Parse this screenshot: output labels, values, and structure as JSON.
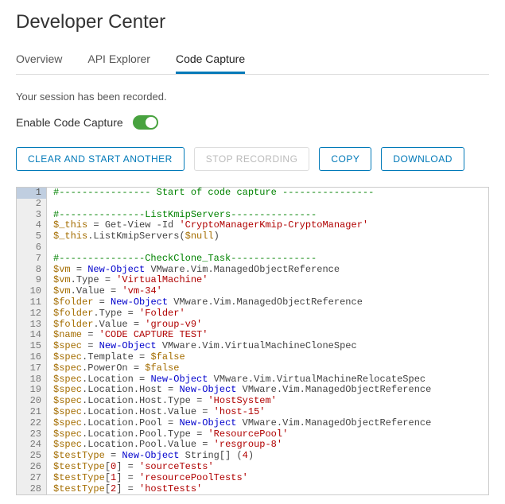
{
  "header": {
    "title": "Developer Center"
  },
  "tabs": {
    "items": [
      {
        "label": "Overview"
      },
      {
        "label": "API Explorer"
      },
      {
        "label": "Code Capture",
        "active": true
      }
    ]
  },
  "message": "Your session has been recorded.",
  "toggle_label": "Enable Code Capture",
  "buttons": {
    "clear": "CLEAR AND START ANOTHER",
    "stop": "STOP RECORDING",
    "copy": "COPY",
    "download": "DOWNLOAD"
  },
  "code": [
    [
      [
        "comment",
        "#---------------- Start of code capture ----------------"
      ]
    ],
    [],
    [
      [
        "comment",
        "#---------------ListKmipServers---------------"
      ]
    ],
    [
      [
        "var",
        "$_this"
      ],
      [
        "sp",
        " "
      ],
      [
        "op",
        "="
      ],
      [
        "sp",
        " "
      ],
      [
        "mem",
        "Get-View -Id "
      ],
      [
        "str",
        "'CryptoManagerKmip-CryptoManager'"
      ]
    ],
    [
      [
        "var",
        "$_this"
      ],
      [
        "punct",
        "."
      ],
      [
        "mem",
        "ListKmipServers"
      ],
      [
        "punct",
        "("
      ],
      [
        "var",
        "$null"
      ],
      [
        "punct",
        ")"
      ]
    ],
    [],
    [
      [
        "comment",
        "#---------------CheckClone_Task---------------"
      ]
    ],
    [
      [
        "var",
        "$vm"
      ],
      [
        "sp",
        " "
      ],
      [
        "op",
        "="
      ],
      [
        "sp",
        " "
      ],
      [
        "kw",
        "New-Object"
      ],
      [
        "sp",
        " "
      ],
      [
        "mem",
        "VMware.Vim.ManagedObjectReference"
      ]
    ],
    [
      [
        "var",
        "$vm"
      ],
      [
        "punct",
        "."
      ],
      [
        "mem",
        "Type"
      ],
      [
        "sp",
        " "
      ],
      [
        "op",
        "="
      ],
      [
        "sp",
        " "
      ],
      [
        "str",
        "'VirtualMachine'"
      ]
    ],
    [
      [
        "var",
        "$vm"
      ],
      [
        "punct",
        "."
      ],
      [
        "mem",
        "Value"
      ],
      [
        "sp",
        " "
      ],
      [
        "op",
        "="
      ],
      [
        "sp",
        " "
      ],
      [
        "str",
        "'vm-34'"
      ]
    ],
    [
      [
        "var",
        "$folder"
      ],
      [
        "sp",
        " "
      ],
      [
        "op",
        "="
      ],
      [
        "sp",
        " "
      ],
      [
        "kw",
        "New-Object"
      ],
      [
        "sp",
        " "
      ],
      [
        "mem",
        "VMware.Vim.ManagedObjectReference"
      ]
    ],
    [
      [
        "var",
        "$folder"
      ],
      [
        "punct",
        "."
      ],
      [
        "mem",
        "Type"
      ],
      [
        "sp",
        " "
      ],
      [
        "op",
        "="
      ],
      [
        "sp",
        " "
      ],
      [
        "str",
        "'Folder'"
      ]
    ],
    [
      [
        "var",
        "$folder"
      ],
      [
        "punct",
        "."
      ],
      [
        "mem",
        "Value"
      ],
      [
        "sp",
        " "
      ],
      [
        "op",
        "="
      ],
      [
        "sp",
        " "
      ],
      [
        "str",
        "'group-v9'"
      ]
    ],
    [
      [
        "var",
        "$name"
      ],
      [
        "sp",
        " "
      ],
      [
        "op",
        "="
      ],
      [
        "sp",
        " "
      ],
      [
        "str",
        "'CODE CAPTURE TEST'"
      ]
    ],
    [
      [
        "var",
        "$spec"
      ],
      [
        "sp",
        " "
      ],
      [
        "op",
        "="
      ],
      [
        "sp",
        " "
      ],
      [
        "kw",
        "New-Object"
      ],
      [
        "sp",
        " "
      ],
      [
        "mem",
        "VMware.Vim.VirtualMachineCloneSpec"
      ]
    ],
    [
      [
        "var",
        "$spec"
      ],
      [
        "punct",
        "."
      ],
      [
        "mem",
        "Template"
      ],
      [
        "sp",
        " "
      ],
      [
        "op",
        "="
      ],
      [
        "sp",
        " "
      ],
      [
        "bool",
        "$false"
      ]
    ],
    [
      [
        "var",
        "$spec"
      ],
      [
        "punct",
        "."
      ],
      [
        "mem",
        "PowerOn"
      ],
      [
        "sp",
        " "
      ],
      [
        "op",
        "="
      ],
      [
        "sp",
        " "
      ],
      [
        "bool",
        "$false"
      ]
    ],
    [
      [
        "var",
        "$spec"
      ],
      [
        "punct",
        "."
      ],
      [
        "mem",
        "Location"
      ],
      [
        "sp",
        " "
      ],
      [
        "op",
        "="
      ],
      [
        "sp",
        " "
      ],
      [
        "kw",
        "New-Object"
      ],
      [
        "sp",
        " "
      ],
      [
        "mem",
        "VMware.Vim.VirtualMachineRelocateSpec"
      ]
    ],
    [
      [
        "var",
        "$spec"
      ],
      [
        "punct",
        "."
      ],
      [
        "mem",
        "Location"
      ],
      [
        "punct",
        "."
      ],
      [
        "mem",
        "Host"
      ],
      [
        "sp",
        " "
      ],
      [
        "op",
        "="
      ],
      [
        "sp",
        " "
      ],
      [
        "kw",
        "New-Object"
      ],
      [
        "sp",
        " "
      ],
      [
        "mem",
        "VMware.Vim.ManagedObjectReference"
      ]
    ],
    [
      [
        "var",
        "$spec"
      ],
      [
        "punct",
        "."
      ],
      [
        "mem",
        "Location"
      ],
      [
        "punct",
        "."
      ],
      [
        "mem",
        "Host"
      ],
      [
        "punct",
        "."
      ],
      [
        "mem",
        "Type"
      ],
      [
        "sp",
        " "
      ],
      [
        "op",
        "="
      ],
      [
        "sp",
        " "
      ],
      [
        "str",
        "'HostSystem'"
      ]
    ],
    [
      [
        "var",
        "$spec"
      ],
      [
        "punct",
        "."
      ],
      [
        "mem",
        "Location"
      ],
      [
        "punct",
        "."
      ],
      [
        "mem",
        "Host"
      ],
      [
        "punct",
        "."
      ],
      [
        "mem",
        "Value"
      ],
      [
        "sp",
        " "
      ],
      [
        "op",
        "="
      ],
      [
        "sp",
        " "
      ],
      [
        "str",
        "'host-15'"
      ]
    ],
    [
      [
        "var",
        "$spec"
      ],
      [
        "punct",
        "."
      ],
      [
        "mem",
        "Location"
      ],
      [
        "punct",
        "."
      ],
      [
        "mem",
        "Pool"
      ],
      [
        "sp",
        " "
      ],
      [
        "op",
        "="
      ],
      [
        "sp",
        " "
      ],
      [
        "kw",
        "New-Object"
      ],
      [
        "sp",
        " "
      ],
      [
        "mem",
        "VMware.Vim.ManagedObjectReference"
      ]
    ],
    [
      [
        "var",
        "$spec"
      ],
      [
        "punct",
        "."
      ],
      [
        "mem",
        "Location"
      ],
      [
        "punct",
        "."
      ],
      [
        "mem",
        "Pool"
      ],
      [
        "punct",
        "."
      ],
      [
        "mem",
        "Type"
      ],
      [
        "sp",
        " "
      ],
      [
        "op",
        "="
      ],
      [
        "sp",
        " "
      ],
      [
        "str",
        "'ResourcePool'"
      ]
    ],
    [
      [
        "var",
        "$spec"
      ],
      [
        "punct",
        "."
      ],
      [
        "mem",
        "Location"
      ],
      [
        "punct",
        "."
      ],
      [
        "mem",
        "Pool"
      ],
      [
        "punct",
        "."
      ],
      [
        "mem",
        "Value"
      ],
      [
        "sp",
        " "
      ],
      [
        "op",
        "="
      ],
      [
        "sp",
        " "
      ],
      [
        "str",
        "'resgroup-8'"
      ]
    ],
    [
      [
        "var",
        "$testType"
      ],
      [
        "sp",
        " "
      ],
      [
        "op",
        "="
      ],
      [
        "sp",
        " "
      ],
      [
        "kw",
        "New-Object"
      ],
      [
        "sp",
        " "
      ],
      [
        "mem",
        "String[] "
      ],
      [
        "punct",
        "("
      ],
      [
        "num",
        "4"
      ],
      [
        "punct",
        ")"
      ]
    ],
    [
      [
        "var",
        "$testType"
      ],
      [
        "punct",
        "["
      ],
      [
        "num",
        "0"
      ],
      [
        "punct",
        "]"
      ],
      [
        "sp",
        " "
      ],
      [
        "op",
        "="
      ],
      [
        "sp",
        " "
      ],
      [
        "str",
        "'sourceTests'"
      ]
    ],
    [
      [
        "var",
        "$testType"
      ],
      [
        "punct",
        "["
      ],
      [
        "num",
        "1"
      ],
      [
        "punct",
        "]"
      ],
      [
        "sp",
        " "
      ],
      [
        "op",
        "="
      ],
      [
        "sp",
        " "
      ],
      [
        "str",
        "'resourcePoolTests'"
      ]
    ],
    [
      [
        "var",
        "$testType"
      ],
      [
        "punct",
        "["
      ],
      [
        "num",
        "2"
      ],
      [
        "punct",
        "]"
      ],
      [
        "sp",
        " "
      ],
      [
        "op",
        "="
      ],
      [
        "sp",
        " "
      ],
      [
        "str",
        "'hostTests'"
      ]
    ]
  ]
}
